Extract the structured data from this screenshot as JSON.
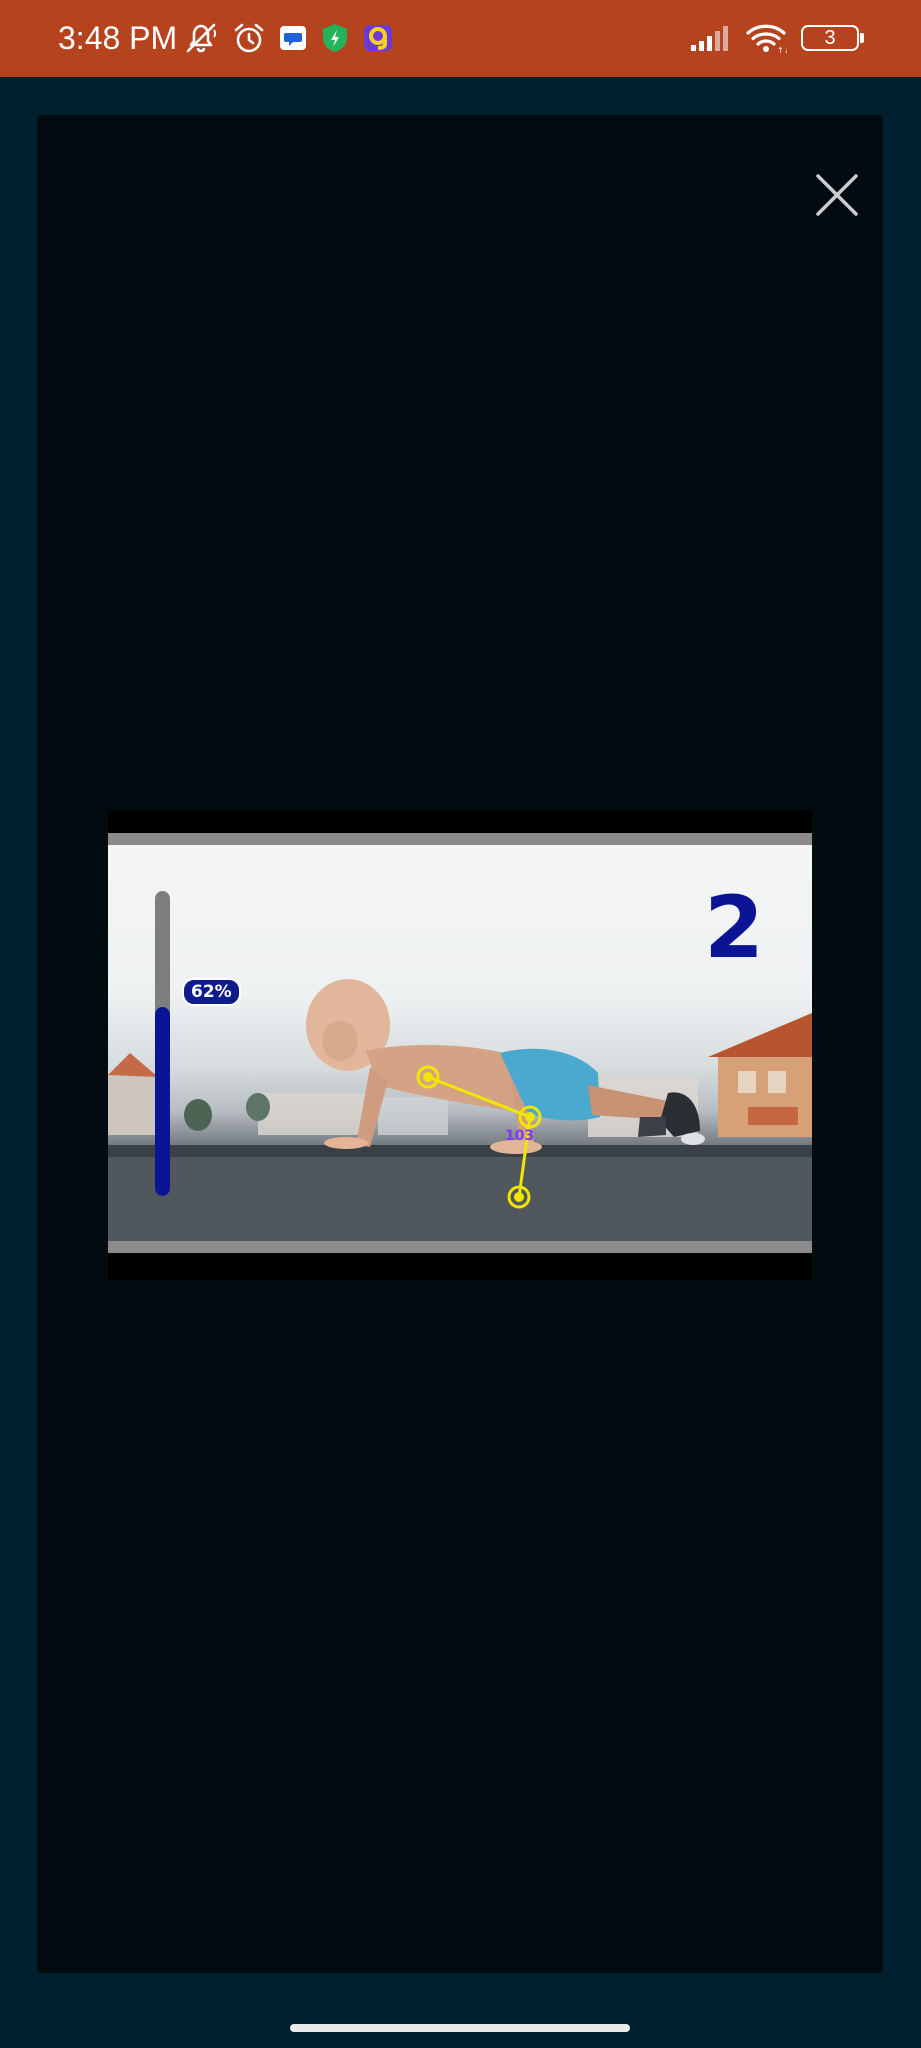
{
  "status_bar": {
    "time": "3:48 PM",
    "battery_level": "3",
    "icons": [
      "mute-bell-icon",
      "alarm-icon",
      "message-app-icon",
      "shield-app-icon",
      "yellow-app-icon",
      "signal-icon",
      "wifi-icon",
      "battery-icon"
    ],
    "background_color": "#b5431e"
  },
  "modal": {
    "background_color": "#010b10",
    "close_icon": "close-icon"
  },
  "video": {
    "progress_percent": 62,
    "progress_label": "62%",
    "rep_count": "2",
    "joint_angle_label": "103",
    "meter_fill_color": "#0a1495",
    "skeleton_color": "#f2e600"
  },
  "page": {
    "background_color": "#00202f"
  }
}
